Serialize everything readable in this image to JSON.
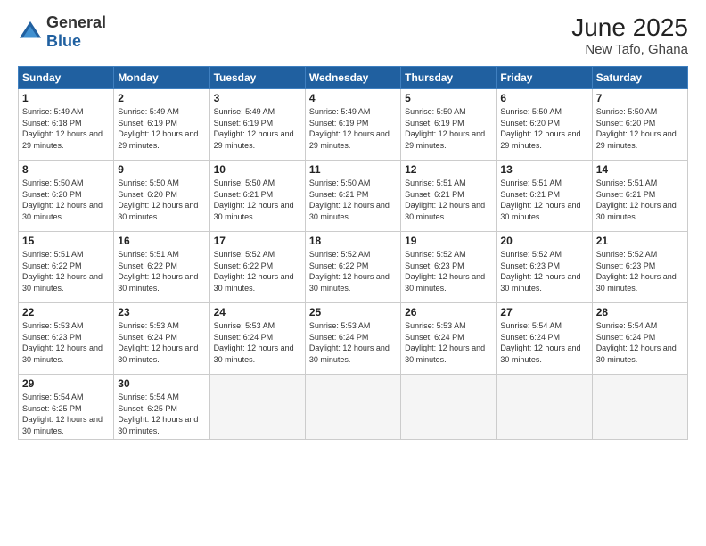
{
  "logo": {
    "general": "General",
    "blue": "Blue"
  },
  "title": "June 2025",
  "subtitle": "New Tafo, Ghana",
  "weekdays": [
    "Sunday",
    "Monday",
    "Tuesday",
    "Wednesday",
    "Thursday",
    "Friday",
    "Saturday"
  ],
  "weeks": [
    [
      {
        "day": "1",
        "sunrise": "5:49 AM",
        "sunset": "6:18 PM",
        "daylight": "12 hours and 29 minutes."
      },
      {
        "day": "2",
        "sunrise": "5:49 AM",
        "sunset": "6:19 PM",
        "daylight": "12 hours and 29 minutes."
      },
      {
        "day": "3",
        "sunrise": "5:49 AM",
        "sunset": "6:19 PM",
        "daylight": "12 hours and 29 minutes."
      },
      {
        "day": "4",
        "sunrise": "5:49 AM",
        "sunset": "6:19 PM",
        "daylight": "12 hours and 29 minutes."
      },
      {
        "day": "5",
        "sunrise": "5:50 AM",
        "sunset": "6:19 PM",
        "daylight": "12 hours and 29 minutes."
      },
      {
        "day": "6",
        "sunrise": "5:50 AM",
        "sunset": "6:20 PM",
        "daylight": "12 hours and 29 minutes."
      },
      {
        "day": "7",
        "sunrise": "5:50 AM",
        "sunset": "6:20 PM",
        "daylight": "12 hours and 29 minutes."
      }
    ],
    [
      {
        "day": "8",
        "sunrise": "5:50 AM",
        "sunset": "6:20 PM",
        "daylight": "12 hours and 30 minutes."
      },
      {
        "day": "9",
        "sunrise": "5:50 AM",
        "sunset": "6:20 PM",
        "daylight": "12 hours and 30 minutes."
      },
      {
        "day": "10",
        "sunrise": "5:50 AM",
        "sunset": "6:21 PM",
        "daylight": "12 hours and 30 minutes."
      },
      {
        "day": "11",
        "sunrise": "5:50 AM",
        "sunset": "6:21 PM",
        "daylight": "12 hours and 30 minutes."
      },
      {
        "day": "12",
        "sunrise": "5:51 AM",
        "sunset": "6:21 PM",
        "daylight": "12 hours and 30 minutes."
      },
      {
        "day": "13",
        "sunrise": "5:51 AM",
        "sunset": "6:21 PM",
        "daylight": "12 hours and 30 minutes."
      },
      {
        "day": "14",
        "sunrise": "5:51 AM",
        "sunset": "6:21 PM",
        "daylight": "12 hours and 30 minutes."
      }
    ],
    [
      {
        "day": "15",
        "sunrise": "5:51 AM",
        "sunset": "6:22 PM",
        "daylight": "12 hours and 30 minutes."
      },
      {
        "day": "16",
        "sunrise": "5:51 AM",
        "sunset": "6:22 PM",
        "daylight": "12 hours and 30 minutes."
      },
      {
        "day": "17",
        "sunrise": "5:52 AM",
        "sunset": "6:22 PM",
        "daylight": "12 hours and 30 minutes."
      },
      {
        "day": "18",
        "sunrise": "5:52 AM",
        "sunset": "6:22 PM",
        "daylight": "12 hours and 30 minutes."
      },
      {
        "day": "19",
        "sunrise": "5:52 AM",
        "sunset": "6:23 PM",
        "daylight": "12 hours and 30 minutes."
      },
      {
        "day": "20",
        "sunrise": "5:52 AM",
        "sunset": "6:23 PM",
        "daylight": "12 hours and 30 minutes."
      },
      {
        "day": "21",
        "sunrise": "5:52 AM",
        "sunset": "6:23 PM",
        "daylight": "12 hours and 30 minutes."
      }
    ],
    [
      {
        "day": "22",
        "sunrise": "5:53 AM",
        "sunset": "6:23 PM",
        "daylight": "12 hours and 30 minutes."
      },
      {
        "day": "23",
        "sunrise": "5:53 AM",
        "sunset": "6:24 PM",
        "daylight": "12 hours and 30 minutes."
      },
      {
        "day": "24",
        "sunrise": "5:53 AM",
        "sunset": "6:24 PM",
        "daylight": "12 hours and 30 minutes."
      },
      {
        "day": "25",
        "sunrise": "5:53 AM",
        "sunset": "6:24 PM",
        "daylight": "12 hours and 30 minutes."
      },
      {
        "day": "26",
        "sunrise": "5:53 AM",
        "sunset": "6:24 PM",
        "daylight": "12 hours and 30 minutes."
      },
      {
        "day": "27",
        "sunrise": "5:54 AM",
        "sunset": "6:24 PM",
        "daylight": "12 hours and 30 minutes."
      },
      {
        "day": "28",
        "sunrise": "5:54 AM",
        "sunset": "6:24 PM",
        "daylight": "12 hours and 30 minutes."
      }
    ],
    [
      {
        "day": "29",
        "sunrise": "5:54 AM",
        "sunset": "6:25 PM",
        "daylight": "12 hours and 30 minutes."
      },
      {
        "day": "30",
        "sunrise": "5:54 AM",
        "sunset": "6:25 PM",
        "daylight": "12 hours and 30 minutes."
      },
      null,
      null,
      null,
      null,
      null
    ]
  ]
}
